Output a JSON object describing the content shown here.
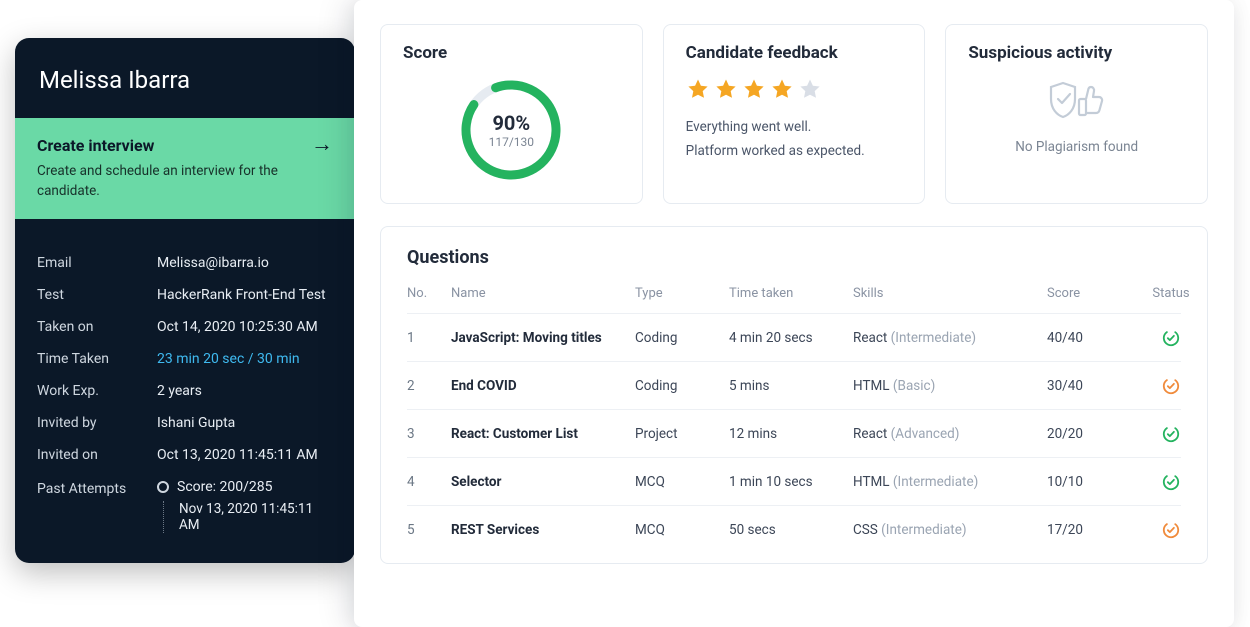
{
  "candidate": {
    "name": "Melissa Ibarra"
  },
  "createInterview": {
    "title": "Create interview",
    "description": "Create and schedule an interview for the candidate."
  },
  "details": {
    "email_label": "Email",
    "email": "Melissa@ibarra.io",
    "test_label": "Test",
    "test": "HackerRank Front-End Test",
    "taken_on_label": "Taken on",
    "taken_on": "Oct 14, 2020  10:25:30 AM",
    "time_taken_label": "Time Taken",
    "time_taken": "23 min 20 sec / 30 min",
    "work_exp_label": "Work Exp.",
    "work_exp": "2 years",
    "invited_by_label": "Invited by",
    "invited_by": "Ishani Gupta",
    "invited_on_label": "Invited on",
    "invited_on": "Oct 13, 2020  11:45:11 AM",
    "past_attempts_label": "Past Attempts",
    "past_attempts": {
      "score_text": "Score: 200/285",
      "date": "Nov 13, 2020  11:45:11 AM"
    }
  },
  "scoreCard": {
    "title": "Score",
    "percent": "90%",
    "fraction": "117/130",
    "percent_value": 90,
    "accent": "#24b35f"
  },
  "feedbackCard": {
    "title": "Candidate feedback",
    "rating": 4,
    "line1": "Everything went well.",
    "line2": "Platform worked as expected."
  },
  "suspiciousCard": {
    "title": "Suspicious activity",
    "text": "No Plagiarism found"
  },
  "questions": {
    "title": "Questions",
    "headers": {
      "no": "No.",
      "name": "Name",
      "type": "Type",
      "time": "Time taken",
      "skills": "Skills",
      "score": "Score",
      "status": "Status"
    },
    "rows": [
      {
        "no": "1",
        "name": "JavaScript: Moving titles",
        "type": "Coding",
        "time": "4 min 20 secs",
        "skill": "React",
        "level": "(Intermediate)",
        "score": "40/40",
        "status": "pass"
      },
      {
        "no": "2",
        "name": "End COVID",
        "type": "Coding",
        "time": "5 mins",
        "skill": "HTML",
        "level": "(Basic)",
        "score": "30/40",
        "status": "partial"
      },
      {
        "no": "3",
        "name": "React: Customer List",
        "type": "Project",
        "time": "12 mins",
        "skill": "React",
        "level": "(Advanced)",
        "score": "20/20",
        "status": "pass"
      },
      {
        "no": "4",
        "name": "Selector",
        "type": "MCQ",
        "time": "1 min 10 secs",
        "skill": "HTML",
        "level": "(Intermediate)",
        "score": "10/10",
        "status": "pass"
      },
      {
        "no": "5",
        "name": "REST Services",
        "type": "MCQ",
        "time": "50 secs",
        "skill": "CSS",
        "level": "(Intermediate)",
        "score": "17/20",
        "status": "partial"
      }
    ]
  },
  "colors": {
    "pass": "#24b35f",
    "partial": "#f08b3c"
  }
}
